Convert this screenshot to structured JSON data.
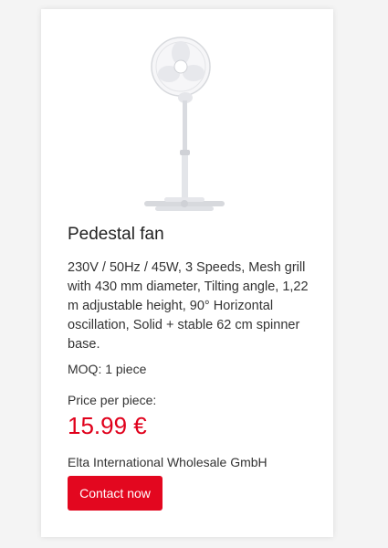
{
  "product": {
    "title": "Pedestal fan",
    "description": "230V / 50Hz / 45W, 3 Speeds, Mesh grill with 430 mm diameter, Tilting angle, 1,22 m adjustable height, 90° Horizontal oscillation, Solid + stable 62 cm spinner base.",
    "moq": "MOQ: 1 piece",
    "price_label": "Price per piece:",
    "price": "15.99 €",
    "seller": "Elta International Wholesale GmbH",
    "contact_label": "Contact now",
    "image_icon": "pedestal-fan-image"
  },
  "colors": {
    "accent": "#e3071f",
    "price": "#e0001b",
    "card": "#ffffff",
    "background": "#f4f4f4"
  }
}
